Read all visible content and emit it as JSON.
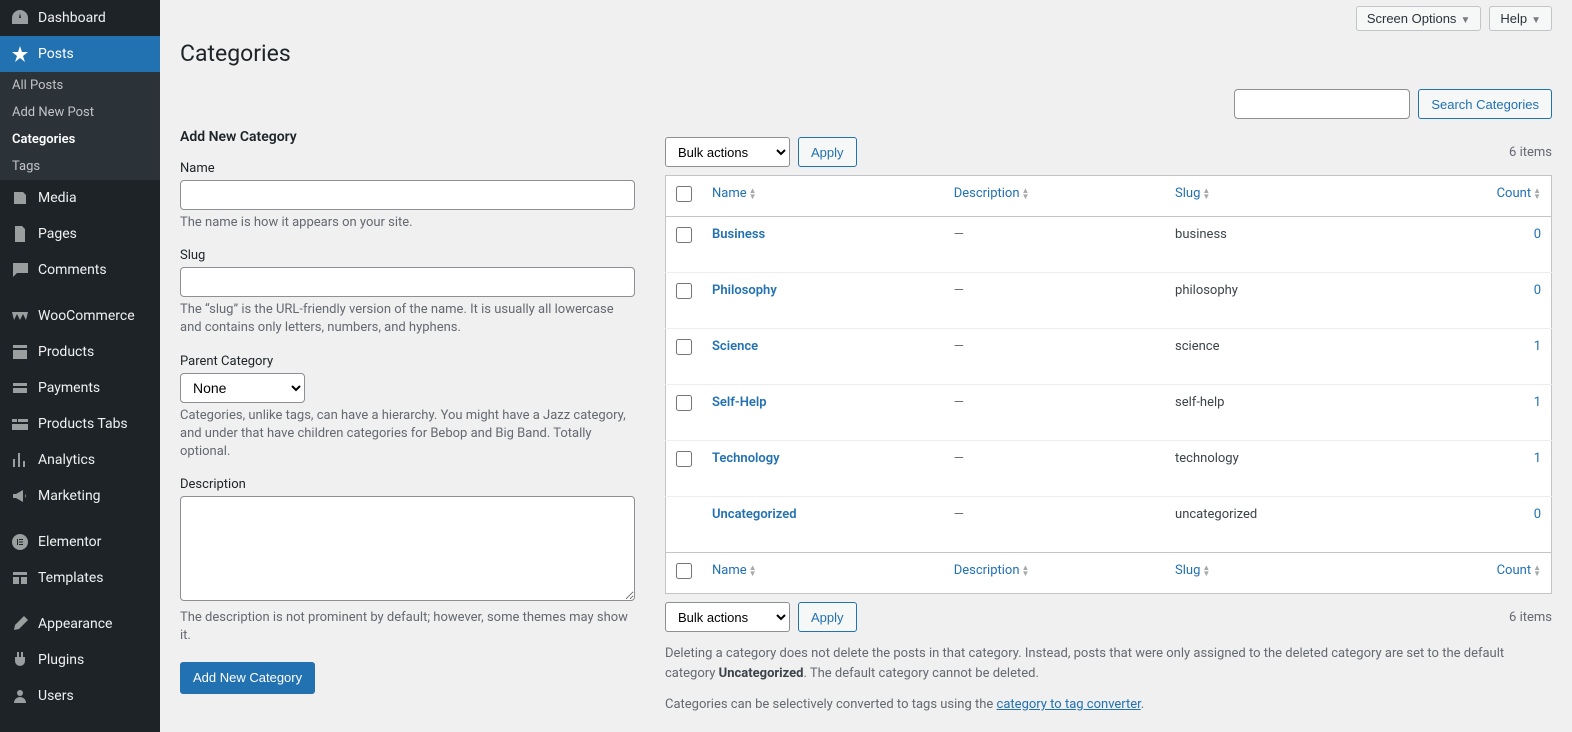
{
  "screen_options": "Screen Options",
  "help": "Help",
  "page_title": "Categories",
  "sidebar": [
    {
      "id": "dashboard",
      "label": "Dashboard"
    },
    {
      "id": "posts",
      "label": "Posts",
      "active": true,
      "sub": [
        {
          "id": "all-posts",
          "label": "All Posts"
        },
        {
          "id": "add-new",
          "label": "Add New Post"
        },
        {
          "id": "categories",
          "label": "Categories",
          "current": true
        },
        {
          "id": "tags",
          "label": "Tags"
        }
      ]
    },
    {
      "id": "media",
      "label": "Media"
    },
    {
      "id": "pages",
      "label": "Pages"
    },
    {
      "id": "comments",
      "label": "Comments"
    },
    {
      "id": "woocommerce",
      "label": "WooCommerce"
    },
    {
      "id": "products",
      "label": "Products"
    },
    {
      "id": "payments",
      "label": "Payments"
    },
    {
      "id": "products-tabs",
      "label": "Products Tabs"
    },
    {
      "id": "analytics",
      "label": "Analytics"
    },
    {
      "id": "marketing",
      "label": "Marketing"
    },
    {
      "id": "elementor",
      "label": "Elementor"
    },
    {
      "id": "templates",
      "label": "Templates"
    },
    {
      "id": "appearance",
      "label": "Appearance"
    },
    {
      "id": "plugins",
      "label": "Plugins"
    },
    {
      "id": "users",
      "label": "Users"
    }
  ],
  "search_button": "Search Categories",
  "add_form": {
    "heading": "Add New Category",
    "name_label": "Name",
    "name_help": "The name is how it appears on your site.",
    "slug_label": "Slug",
    "slug_help": "The “slug” is the URL-friendly version of the name. It is usually all lowercase and contains only letters, numbers, and hyphens.",
    "parent_label": "Parent Category",
    "parent_selected": "None",
    "parent_help": "Categories, unlike tags, can have a hierarchy. You might have a Jazz category, and under that have children categories for Bebop and Big Band. Totally optional.",
    "desc_label": "Description",
    "desc_help": "The description is not prominent by default; however, some themes may show it.",
    "submit": "Add New Category"
  },
  "bulk_actions_label": "Bulk actions",
  "apply_label": "Apply",
  "items_count": "6 items",
  "columns": {
    "name": "Name",
    "description": "Description",
    "slug": "Slug",
    "count": "Count"
  },
  "rows": [
    {
      "name": "Business",
      "description": "—",
      "slug": "business",
      "count": "0",
      "checkbox": true
    },
    {
      "name": "Philosophy",
      "description": "—",
      "slug": "philosophy",
      "count": "0",
      "checkbox": true
    },
    {
      "name": "Science",
      "description": "—",
      "slug": "science",
      "count": "1",
      "checkbox": true
    },
    {
      "name": "Self-Help",
      "description": "—",
      "slug": "self-help",
      "count": "1",
      "checkbox": true
    },
    {
      "name": "Technology",
      "description": "—",
      "slug": "technology",
      "count": "1",
      "checkbox": true
    },
    {
      "name": "Uncategorized",
      "description": "—",
      "slug": "uncategorized",
      "count": "0",
      "checkbox": false
    }
  ],
  "notes": {
    "p1a": "Deleting a category does not delete the posts in that category. Instead, posts that were only assigned to the deleted category are set to the default category ",
    "p1b": "Uncategorized",
    "p1c": ". The default category cannot be deleted.",
    "p2a": "Categories can be selectively converted to tags using the ",
    "p2b": "category to tag converter",
    "p2c": "."
  }
}
